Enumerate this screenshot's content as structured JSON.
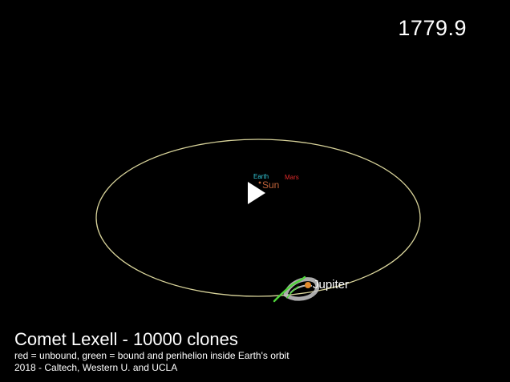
{
  "timestamp": "1779.9",
  "labels": {
    "earth": "Earth",
    "mars": "Mars",
    "sun": "Sun",
    "jupiter": "Jupiter"
  },
  "caption": {
    "title": "Comet Lexell - 10000 clones",
    "legend": "red = unbound, green = bound and perihelion inside Earth's orbit",
    "credit": "2018 - Caltech, Western U. and UCLA"
  },
  "colors": {
    "background": "#000000",
    "jupiter_orbit": "#d8d39a",
    "earth_label": "#33c6d6",
    "mars_label": "#e02a2a",
    "sun_label": "#c0633a",
    "jupiter_label": "#ffffff",
    "clone_cloud": "#c9c9c9",
    "bound_clones": "#4fd33a",
    "jupiter_body": "#e28a2d"
  },
  "icons": {
    "play": "play-icon"
  }
}
